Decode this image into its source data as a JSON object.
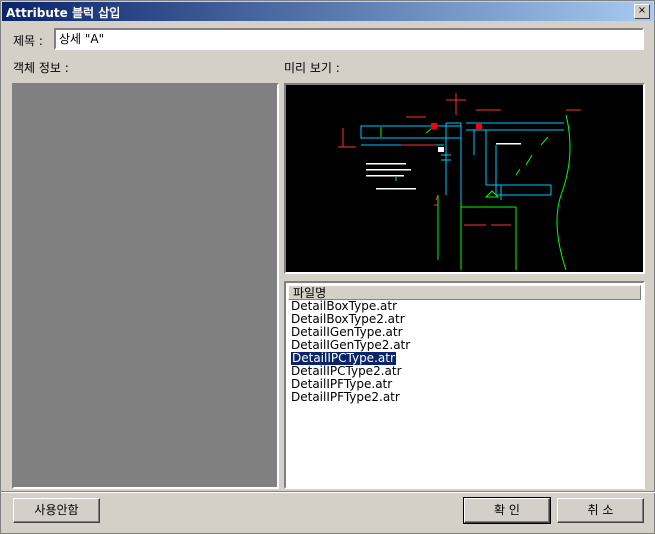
{
  "window": {
    "title": "Attribute 블럭 삽입",
    "close_glyph": "×"
  },
  "form": {
    "title_label": "제목 :",
    "title_value": "상세 \"A\"",
    "object_info_label": "객체 정보 :",
    "preview_label": "미리 보기 :"
  },
  "filelist": {
    "header": "파일명",
    "items": [
      "DetailBoxType.atr",
      "DetailBoxType2.atr",
      "DetailIGenType.atr",
      "DetailIGenType2.atr",
      "DetailIPCType.atr",
      "DetailIPCType2.atr",
      "DetailIPFType.atr",
      "DetailIPFType2.atr"
    ],
    "selected_index": 4
  },
  "buttons": {
    "not_use": "사용안함",
    "ok": "확 인",
    "cancel": "취 소"
  },
  "colors": {
    "titlebar_start": "#0a246a",
    "titlebar_end": "#a6caf0",
    "dialog_bg": "#d4d0c8",
    "selection": "#0a246a"
  }
}
